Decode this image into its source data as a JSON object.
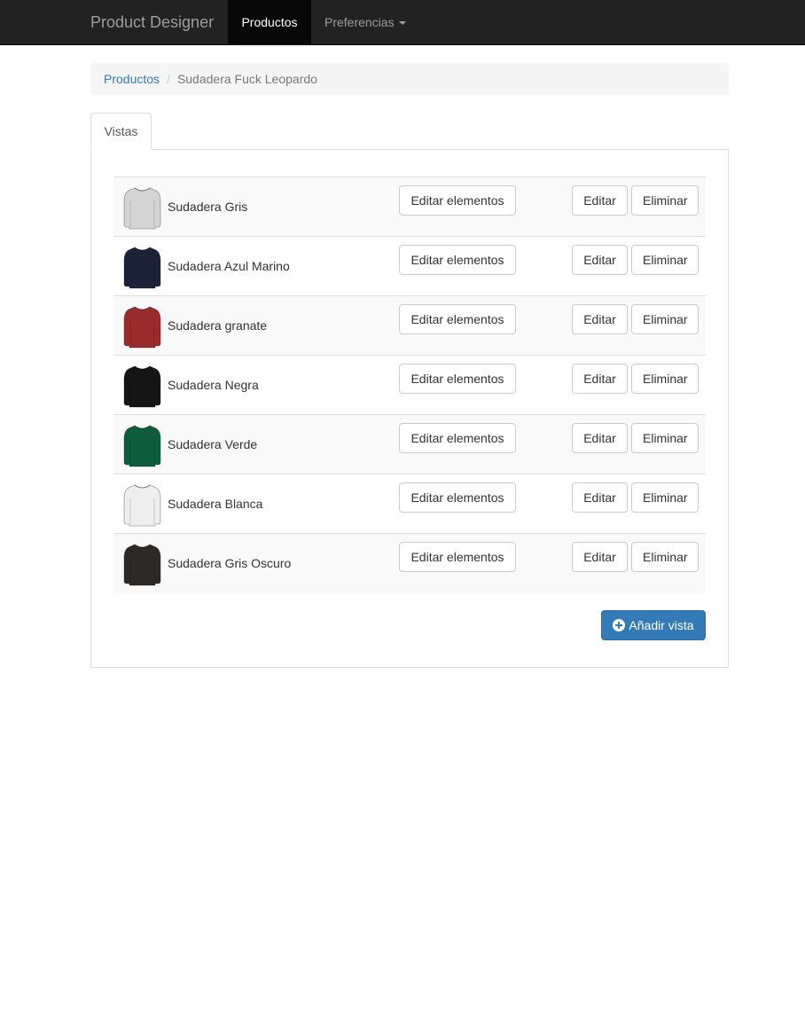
{
  "navbar": {
    "brand": "Product Designer",
    "active_item": "Productos",
    "dropdown_item": "Preferencias"
  },
  "breadcrumb": {
    "link": "Productos",
    "separator": "/",
    "current": "Sudadera Fuck Leopardo"
  },
  "tabs": [
    {
      "label": "Vistas"
    }
  ],
  "buttons": {
    "edit_elements": "Editar elementos",
    "edit": "Editar",
    "delete": "Eliminar",
    "add_view": "Añadir vista"
  },
  "views": [
    {
      "name": "Sudadera Gris",
      "color": "#d4d4d4"
    },
    {
      "name": "Sudadera Azul Marino",
      "color": "#1c2238"
    },
    {
      "name": "Sudadera granate",
      "color": "#9a2b2b"
    },
    {
      "name": "Sudadera Negra",
      "color": "#151515"
    },
    {
      "name": "Sudadera Verde",
      "color": "#0e5c3c"
    },
    {
      "name": "Sudadera Blanca",
      "color": "#eeeeee"
    },
    {
      "name": "Sudadera Gris Oscuro",
      "color": "#2b2a27"
    }
  ],
  "colors": {
    "navbar_bg": "#222222",
    "primary": "#337ab7",
    "link": "#337ab7"
  }
}
